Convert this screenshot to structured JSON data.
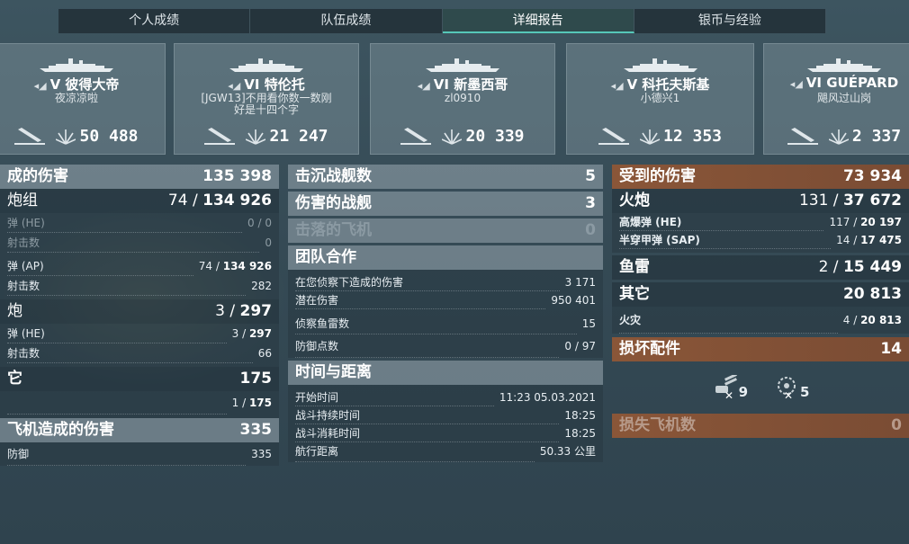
{
  "tabs": [
    "个人成绩",
    "队伍成绩",
    "详细报告",
    "银币与经验"
  ],
  "active_tab": 2,
  "ships": [
    {
      "tier": "V",
      "name": "彼得大帝",
      "player": "夜凉凉啦",
      "player2": "",
      "damage": "50 488"
    },
    {
      "tier": "VI",
      "name": "特伦托",
      "player": "[JGW13]不用看你数一数刚",
      "player2": "好是十四个字",
      "damage": "21 247"
    },
    {
      "tier": "VI",
      "name": "新墨西哥",
      "player": "zl0910",
      "player2": "",
      "damage": "20 339"
    },
    {
      "tier": "V",
      "name": "科托夫斯基",
      "player": "小德兴1",
      "player2": "",
      "damage": "12 353"
    },
    {
      "tier": "VI",
      "name": "GUÉPARD",
      "player": "飓风过山岗",
      "player2": "",
      "damage": "2 337"
    }
  ],
  "left": {
    "dmg_label": "成的伤害",
    "dmg_value": "135 398",
    "main": {
      "label": "炮组",
      "a": "74",
      "b": "134 926"
    },
    "he": {
      "label": "弹 (HE)",
      "v": "0 / 0"
    },
    "he_hits": {
      "label": "射击数",
      "v": "0"
    },
    "ap": {
      "label": "弹 (AP)",
      "a": "74",
      "b": "134 926"
    },
    "ap_hits": {
      "label": "射击数",
      "v": "282"
    },
    "sec": {
      "label": "炮",
      "a": "3",
      "b": "297"
    },
    "sec_he": {
      "label": "弹 (HE)",
      "a": "3",
      "b": "297"
    },
    "sec_hits": {
      "label": "射击数",
      "v": "66"
    },
    "other": {
      "label": "它",
      "v": "175"
    },
    "other_sub": {
      "label": "",
      "a": "1",
      "b": "175"
    },
    "air": {
      "label": "飞机造成的伤害",
      "v": "335"
    },
    "air_sub": {
      "label": "防御",
      "v": "335"
    }
  },
  "mid": {
    "sunk": {
      "label": "击沉战舰数",
      "v": "5"
    },
    "damaged": {
      "label": "伤害的战舰",
      "v": "3"
    },
    "planes": {
      "label": "击落的飞机",
      "v": "0"
    },
    "team": "团队合作",
    "spot_dmg": {
      "label": "在您侦察下造成的伤害",
      "v": "3 171"
    },
    "potential": {
      "label": "潜在伤害",
      "v": "950 401"
    },
    "torp_spot": {
      "label": "侦察鱼雷数",
      "v": "15"
    },
    "defense": {
      "label": "防御点数",
      "v": "0 / 97"
    },
    "time_hdr": "时间与距离",
    "start": {
      "label": "开始时间",
      "v": "11:23   05.03.2021"
    },
    "duration": {
      "label": "战斗持续时间",
      "v": "18:25"
    },
    "spent": {
      "label": "战斗消耗时间",
      "v": "18:25"
    },
    "distance": {
      "label": "航行距离",
      "v": "50.33 公里"
    }
  },
  "right": {
    "recv": {
      "label": "受到的伤害",
      "v": "73 934"
    },
    "guns": {
      "label": "火炮",
      "a": "131",
      "b": "37 672"
    },
    "he": {
      "label": "高爆弹 (HE)",
      "a": "117",
      "b": "20 197"
    },
    "sap": {
      "label": "半穿甲弹 (SAP)",
      "a": "14",
      "b": "17 475"
    },
    "torp": {
      "label": "鱼雷",
      "a": "2",
      "b": "15 449"
    },
    "other": {
      "label": "其它",
      "v": "20 813"
    },
    "fire": {
      "label": "火灾",
      "a": "4",
      "b": "20 813"
    },
    "modules": {
      "label": "损坏配件",
      "v": "14"
    },
    "mod_icons": [
      {
        "icon": "turret-icon",
        "v": "9"
      },
      {
        "icon": "steering-icon",
        "v": "5"
      }
    ],
    "lost": {
      "label": "损失飞机数",
      "v": "0"
    }
  },
  "colors": {
    "accent": "#56c7b8",
    "copper": "#8a5638"
  }
}
